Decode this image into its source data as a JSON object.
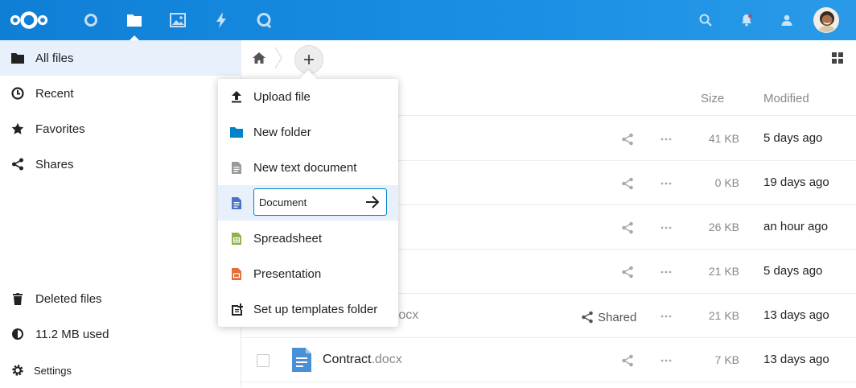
{
  "header": {
    "apps": [
      "dashboard-icon",
      "files-icon",
      "photos-icon",
      "activity-icon",
      "talk-icon"
    ],
    "right_icons": [
      "search-icon",
      "notifications-icon",
      "contacts-icon"
    ]
  },
  "sidebar": {
    "items": [
      {
        "label": "All files",
        "icon": "folder-icon"
      },
      {
        "label": "Recent",
        "icon": "clock-icon"
      },
      {
        "label": "Favorites",
        "icon": "star-icon"
      },
      {
        "label": "Shares",
        "icon": "share-icon"
      }
    ],
    "deleted_label": "Deleted files",
    "quota_label": "11.2 MB used",
    "settings_label": "Settings"
  },
  "table": {
    "headers": {
      "size": "Size",
      "modified": "Modified"
    },
    "rows": [
      {
        "size": "41 KB",
        "modified": "5 days ago"
      },
      {
        "size": "0 KB",
        "modified": "19 days ago"
      },
      {
        "size": "26 KB",
        "modified": "an hour ago"
      },
      {
        "size": "21 KB",
        "modified": "5 days ago"
      },
      {
        "name_ext": ".docx",
        "shared_label": "Shared",
        "size": "21 KB",
        "modified": "13 days ago"
      },
      {
        "name": "Contract",
        "name_ext": ".docx",
        "size": "7 KB",
        "modified": "13 days ago"
      }
    ]
  },
  "new_menu": {
    "items": [
      {
        "label": "Upload file",
        "icon": "upload-icon"
      },
      {
        "label": "New folder",
        "icon": "folder-icon"
      },
      {
        "label": "New text document",
        "icon": "text-document-icon"
      },
      {
        "input_value": "Document",
        "icon": "document-icon"
      },
      {
        "label": "Spreadsheet",
        "icon": "spreadsheet-icon"
      },
      {
        "label": "Presentation",
        "icon": "presentation-icon"
      },
      {
        "label": "Set up templates folder",
        "icon": "template-folder-icon"
      }
    ]
  },
  "colors": {
    "header": "#1a8fe3",
    "accent": "#0082c9",
    "highlight": "#e8f1fb"
  }
}
